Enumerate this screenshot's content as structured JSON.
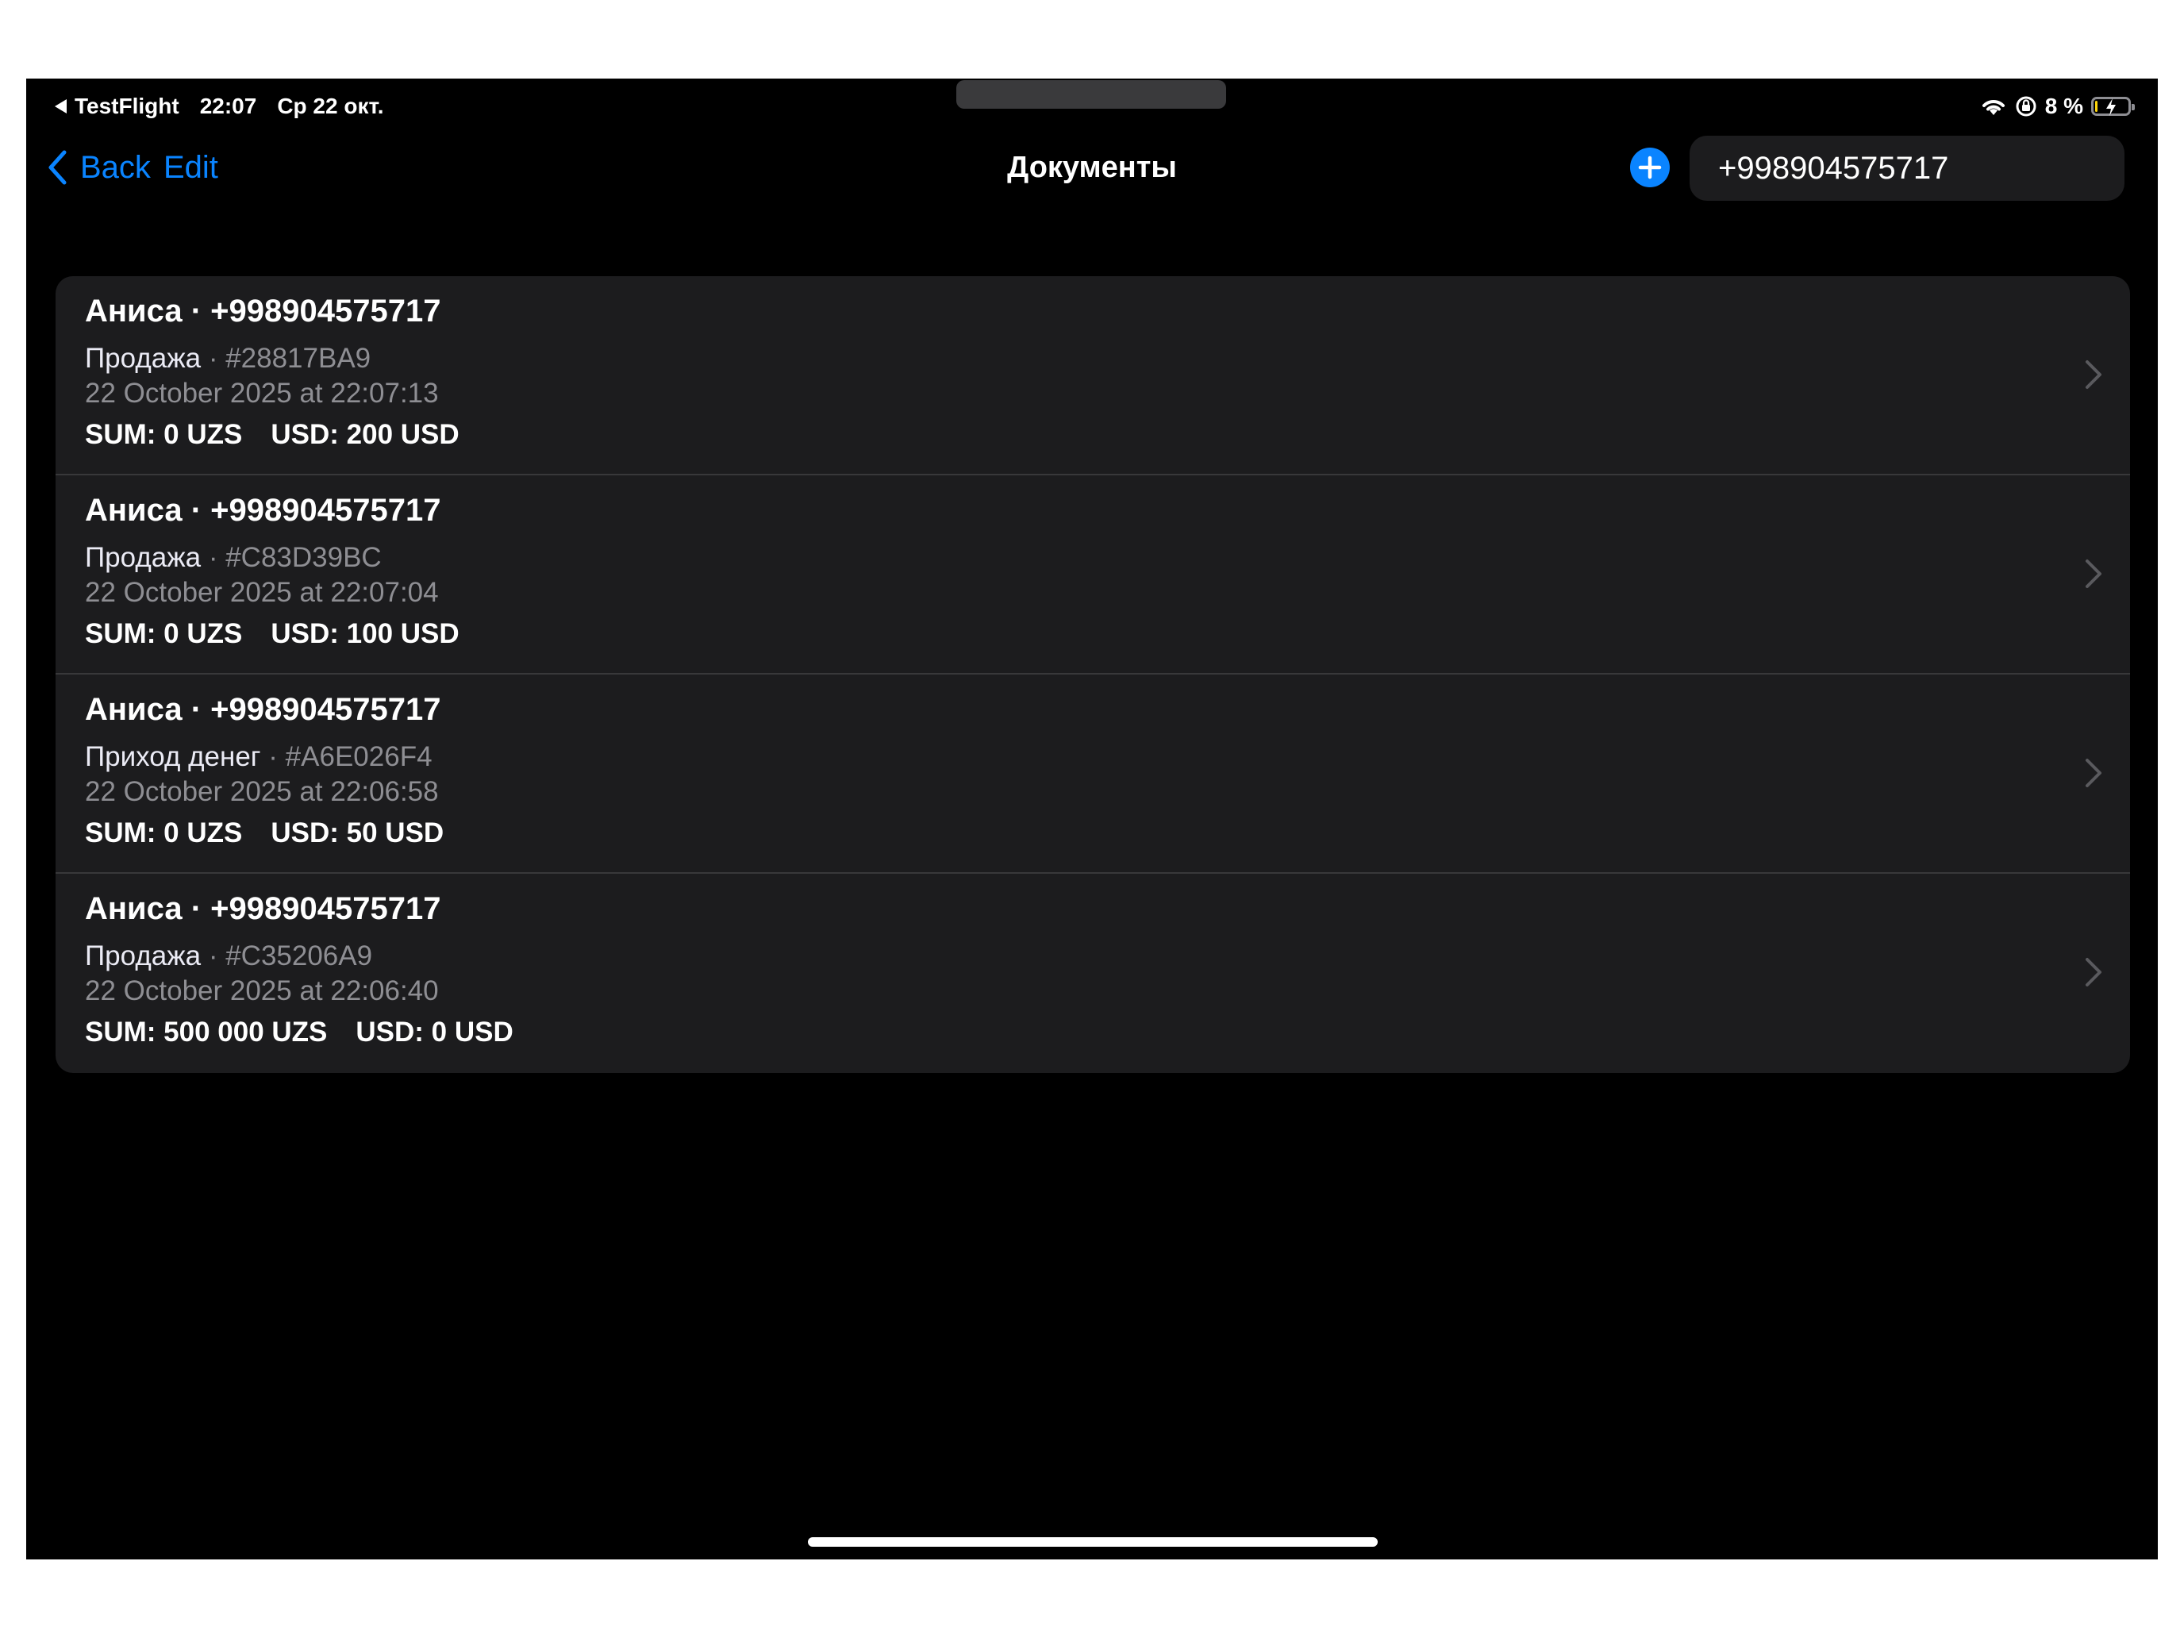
{
  "status_bar": {
    "back_app": "TestFlight",
    "time": "22:07",
    "date": "Ср 22 окт.",
    "battery_percent": "8 %",
    "battery_level": 0.08
  },
  "nav": {
    "back_label": "Back",
    "edit_label": "Edit",
    "title": "Документы"
  },
  "search": {
    "value": "+998904575717"
  },
  "documents": [
    {
      "title": "Аниса · +998904575717",
      "type": "Продажа",
      "code": " · #28817BA9",
      "date": "22 October 2025 at 22:07:13",
      "sum": "SUM: 0 UZS",
      "usd": "USD: 200 USD"
    },
    {
      "title": "Аниса · +998904575717",
      "type": "Продажа",
      "code": " · #C83D39BC",
      "date": "22 October 2025 at 22:07:04",
      "sum": "SUM: 0 UZS",
      "usd": "USD: 100 USD"
    },
    {
      "title": "Аниса · +998904575717",
      "type": "Приход денег",
      "code": " · #A6E026F4",
      "date": "22 October 2025 at 22:06:58",
      "sum": "SUM: 0 UZS",
      "usd": "USD: 50 USD"
    },
    {
      "title": "Аниса · +998904575717",
      "type": "Продажа",
      "code": " · #C35206A9",
      "date": "22 October 2025 at 22:06:40",
      "sum": "SUM: 500 000 UZS",
      "usd": "USD: 0 USD"
    }
  ],
  "colors": {
    "accent": "#0a84ff",
    "background": "#000000",
    "card": "#1c1c1e",
    "secondary_text": "#8e8e93"
  }
}
